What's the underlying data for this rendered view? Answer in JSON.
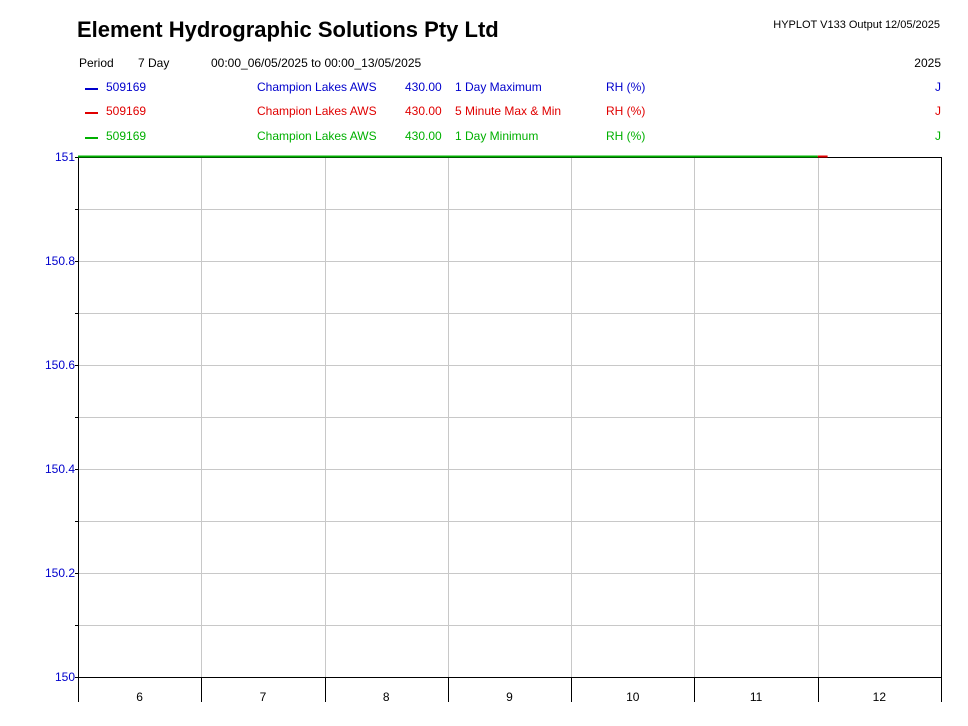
{
  "header": {
    "company": "Element Hydrographic Solutions Pty Ltd",
    "version": "HYPLOT V133  Output 12/05/2025",
    "period_label": "Period",
    "period_value": "7 Day",
    "date_range": "00:00_06/05/2025 to 00:00_13/05/2025",
    "year": "2025"
  },
  "legend": [
    {
      "site": "509169",
      "name": "Champion Lakes AWS",
      "var": "430.00",
      "stat": "1 Day Maximum",
      "unit": "RH (%)",
      "flag": "J",
      "color": "#0000cc"
    },
    {
      "site": "509169",
      "name": "Champion Lakes AWS",
      "var": "430.00",
      "stat": "5 Minute Max & Min",
      "unit": "RH (%)",
      "flag": "J",
      "color": "#e00000"
    },
    {
      "site": "509169",
      "name": "Champion Lakes AWS",
      "var": "430.00",
      "stat": "1 Day Minimum",
      "unit": "RH (%)",
      "flag": "J",
      "color": "#00b000"
    }
  ],
  "chart_data": {
    "type": "line",
    "title": "",
    "xlabel": "",
    "ylabel": "",
    "categories": [
      "6",
      "7",
      "8",
      "9",
      "10",
      "11",
      "12"
    ],
    "xlim": [
      0,
      7
    ],
    "ylim": [
      150,
      151
    ],
    "yticks": [
      {
        "value": 150,
        "label": "150"
      },
      {
        "value": 150.2,
        "label": "150.2"
      },
      {
        "value": 150.4,
        "label": "150.4"
      },
      {
        "value": 150.6,
        "label": "150.6"
      },
      {
        "value": 150.8,
        "label": "150.8"
      },
      {
        "value": 151,
        "label": "151"
      }
    ],
    "grid": true,
    "series": [
      {
        "name": "1 Day Maximum",
        "color": "#0000cc",
        "x": [],
        "y": []
      },
      {
        "name": "5 Minute Max & Min",
        "color": "#e00000",
        "x": [
          6.0,
          6.08
        ],
        "y": [
          151,
          151
        ]
      },
      {
        "name": "1 Day Minimum",
        "color": "#00b000",
        "x": [
          0,
          6.0
        ],
        "y": [
          151,
          151
        ]
      }
    ]
  }
}
